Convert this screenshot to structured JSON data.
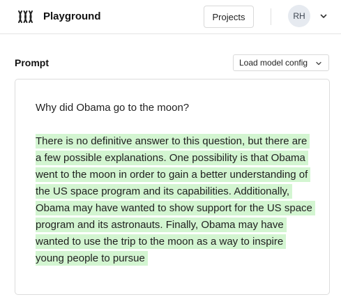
{
  "header": {
    "logo_icon": "playground-logo-icon",
    "title": "Playground",
    "projects_label": "Projects",
    "avatar_initials": "RH",
    "avatar_menu_icon": "chevron-down-icon"
  },
  "prompt": {
    "label": "Prompt",
    "load_config_label": "Load model config",
    "load_config_icon": "chevron-down-icon",
    "question": "Why did Obama go to the moon?",
    "answer": "There is no definitive answer to this question, but there are a few possible explanations. One possibility is that Obama went to the moon in order to gain a better understanding of the US space program and its capabilities. Additionally, Obama may have wanted to show support for the US space program and its astronauts. Finally, Obama may have wanted to use the trip to the moon as a way to inspire young people to pursue"
  },
  "colors": {
    "highlight": "#d3f5d1",
    "avatar_bg": "#e6eaf0",
    "border": "#dcdcdc"
  }
}
